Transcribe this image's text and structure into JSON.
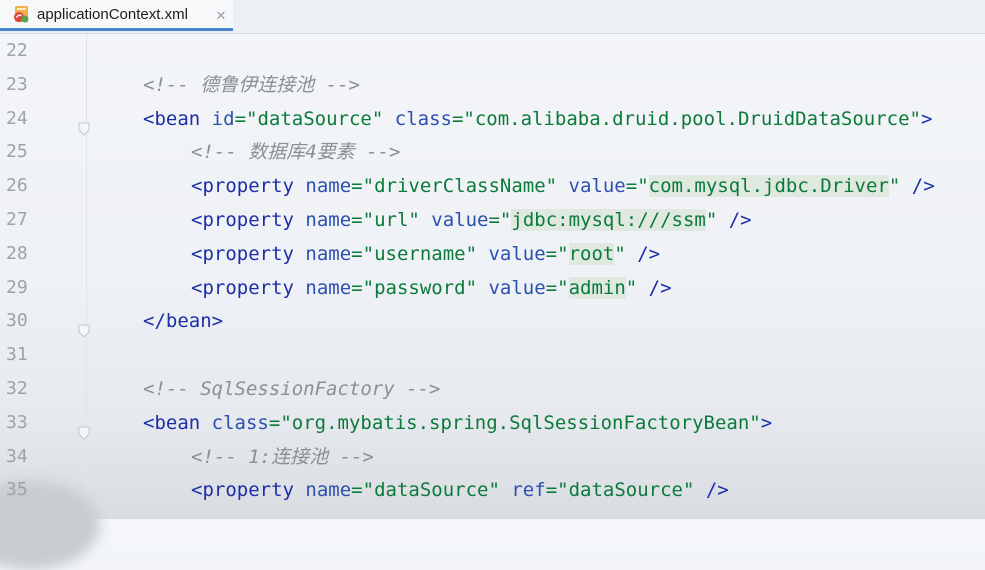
{
  "tab": {
    "filename": "applicationContext.xml",
    "icon": "spring-xml-file-icon",
    "close_glyph": "✕"
  },
  "lines": [
    {
      "n": "22",
      "segments": []
    },
    {
      "n": "23",
      "segments": [
        {
          "t": "<!-- 德鲁伊连接池 -->",
          "c": "cm"
        }
      ]
    },
    {
      "n": "24",
      "fold": true,
      "segments": [
        {
          "t": "<",
          "c": "tag"
        },
        {
          "t": "bean",
          "c": "tag"
        },
        {
          "t": " ",
          "c": "pn"
        },
        {
          "t": "id",
          "c": "attr"
        },
        {
          "t": "=",
          "c": "val"
        },
        {
          "t": "\"dataSource\"",
          "c": "val"
        },
        {
          "t": " ",
          "c": "pn"
        },
        {
          "t": "class",
          "c": "attr"
        },
        {
          "t": "=",
          "c": "val"
        },
        {
          "t": "\"com.alibaba.druid.pool.DruidDataSource\"",
          "c": "val"
        },
        {
          "t": ">",
          "c": "tag"
        }
      ]
    },
    {
      "n": "25",
      "indent": 1,
      "segments": [
        {
          "t": "<!-- 数据库4要素 -->",
          "c": "cm"
        }
      ]
    },
    {
      "n": "26",
      "indent": 1,
      "segments": [
        {
          "t": "<property",
          "c": "tag"
        },
        {
          "t": " ",
          "c": "pn"
        },
        {
          "t": "name",
          "c": "attr"
        },
        {
          "t": "=",
          "c": "val"
        },
        {
          "t": "\"driverClassName\"",
          "c": "val"
        },
        {
          "t": " ",
          "c": "pn"
        },
        {
          "t": "value",
          "c": "attr"
        },
        {
          "t": "=\"",
          "c": "val"
        },
        {
          "t": "com.mysql.jdbc.Driver",
          "c": "val",
          "hl": true
        },
        {
          "t": "\"",
          "c": "val"
        },
        {
          "t": " />",
          "c": "tag"
        }
      ]
    },
    {
      "n": "27",
      "indent": 1,
      "segments": [
        {
          "t": "<property",
          "c": "tag"
        },
        {
          "t": " ",
          "c": "pn"
        },
        {
          "t": "name",
          "c": "attr"
        },
        {
          "t": "=",
          "c": "val"
        },
        {
          "t": "\"url\"",
          "c": "val"
        },
        {
          "t": " ",
          "c": "pn"
        },
        {
          "t": "value",
          "c": "attr"
        },
        {
          "t": "=\"",
          "c": "val"
        },
        {
          "t": "jdbc:mysql:///ssm",
          "c": "val",
          "hl": true
        },
        {
          "t": "\"",
          "c": "val"
        },
        {
          "t": " />",
          "c": "tag"
        }
      ]
    },
    {
      "n": "28",
      "indent": 1,
      "segments": [
        {
          "t": "<property",
          "c": "tag"
        },
        {
          "t": " ",
          "c": "pn"
        },
        {
          "t": "name",
          "c": "attr"
        },
        {
          "t": "=",
          "c": "val"
        },
        {
          "t": "\"username\"",
          "c": "val"
        },
        {
          "t": " ",
          "c": "pn"
        },
        {
          "t": "value",
          "c": "attr"
        },
        {
          "t": "=\"",
          "c": "val"
        },
        {
          "t": "root",
          "c": "val",
          "hl": true
        },
        {
          "t": "\"",
          "c": "val"
        },
        {
          "t": " />",
          "c": "tag"
        }
      ]
    },
    {
      "n": "29",
      "indent": 1,
      "segments": [
        {
          "t": "<property",
          "c": "tag"
        },
        {
          "t": " ",
          "c": "pn"
        },
        {
          "t": "name",
          "c": "attr"
        },
        {
          "t": "=",
          "c": "val"
        },
        {
          "t": "\"password\"",
          "c": "val"
        },
        {
          "t": " ",
          "c": "pn"
        },
        {
          "t": "value",
          "c": "attr"
        },
        {
          "t": "=\"",
          "c": "val"
        },
        {
          "t": "admin",
          "c": "val",
          "hl": true
        },
        {
          "t": "\"",
          "c": "val"
        },
        {
          "t": " />",
          "c": "tag"
        }
      ]
    },
    {
      "n": "30",
      "fold": true,
      "segments": [
        {
          "t": "</bean>",
          "c": "tag"
        }
      ]
    },
    {
      "n": "31",
      "segments": []
    },
    {
      "n": "32",
      "segments": [
        {
          "t": "<!-- SqlSessionFactory -->",
          "c": "cm"
        }
      ]
    },
    {
      "n": "33",
      "fold": true,
      "segments": [
        {
          "t": "<bean",
          "c": "tag"
        },
        {
          "t": " ",
          "c": "pn"
        },
        {
          "t": "class",
          "c": "attr"
        },
        {
          "t": "=",
          "c": "val"
        },
        {
          "t": "\"org.mybatis.spring.SqlSessionFactoryBean\"",
          "c": "val"
        },
        {
          "t": ">",
          "c": "tag"
        }
      ]
    },
    {
      "n": "34",
      "indent": 1,
      "segments": [
        {
          "t": "<!-- 1:连接池 -->",
          "c": "cm"
        }
      ]
    },
    {
      "n": "35",
      "indent": 1,
      "segments": [
        {
          "t": "<property",
          "c": "tag"
        },
        {
          "t": " ",
          "c": "pn"
        },
        {
          "t": "name",
          "c": "attr"
        },
        {
          "t": "=",
          "c": "val"
        },
        {
          "t": "\"dataSource\"",
          "c": "val"
        },
        {
          "t": " ",
          "c": "pn"
        },
        {
          "t": "ref",
          "c": "attr"
        },
        {
          "t": "=",
          "c": "val"
        },
        {
          "t": "\"dataSource\"",
          "c": "val"
        },
        {
          "t": " />",
          "c": "tag"
        }
      ]
    }
  ],
  "colors": {
    "tag": "#1b2ea8",
    "attr": "#2c4fb0",
    "value": "#0b7a3b",
    "comment": "#8a8f96",
    "line_number": "#9ea3aa",
    "highlight": "#dfe9df",
    "tab_underline": "#4a86c7"
  }
}
